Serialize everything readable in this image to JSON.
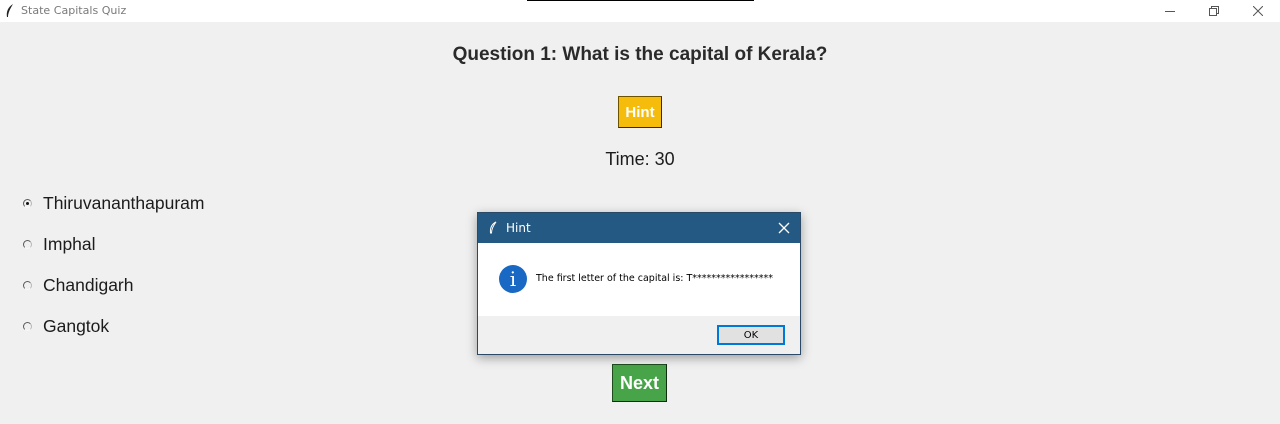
{
  "window": {
    "title": "State Capitals Quiz"
  },
  "quiz": {
    "question": "Question 1: What is the capital of Kerala?",
    "hint_label": "Hint",
    "timer": "Time: 30",
    "options": [
      {
        "label": "Thiruvananthapuram",
        "selected": true
      },
      {
        "label": "Imphal",
        "selected": false
      },
      {
        "label": "Chandigarh",
        "selected": false
      },
      {
        "label": "Gangtok",
        "selected": false
      }
    ],
    "next_label": "Next"
  },
  "dialog": {
    "title": "Hint",
    "icon": "info-icon",
    "message": "The first letter of the capital is: T*****************",
    "ok_label": "OK"
  },
  "colors": {
    "hint_button": "#f5bc0c",
    "next_button": "#48a448",
    "dialog_titlebar": "#235982",
    "info_icon": "#1868c4"
  }
}
